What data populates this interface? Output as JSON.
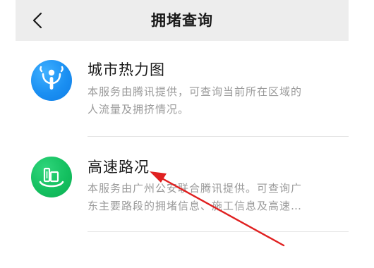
{
  "nav": {
    "title": "拥堵查询",
    "back_icon": "chevron-left-icon"
  },
  "services": [
    {
      "title": "城市热力图",
      "description_lines": [
        "本服务由腾讯提供，可查询当前所在区域的",
        "人流量及拥挤情况。"
      ],
      "icon": "heatmap-person-icon",
      "icon_color": "#1a8ff2"
    },
    {
      "title": "高速路况",
      "description_lines": [
        "本服务由广州公安联合腾讯提供。可查询广",
        "东主要路段的拥堵信息、施工信息及高速…"
      ],
      "icon": "highway-city-icon",
      "icon_color": "#14c060"
    }
  ],
  "annotation": {
    "arrow_color": "#e02020"
  }
}
